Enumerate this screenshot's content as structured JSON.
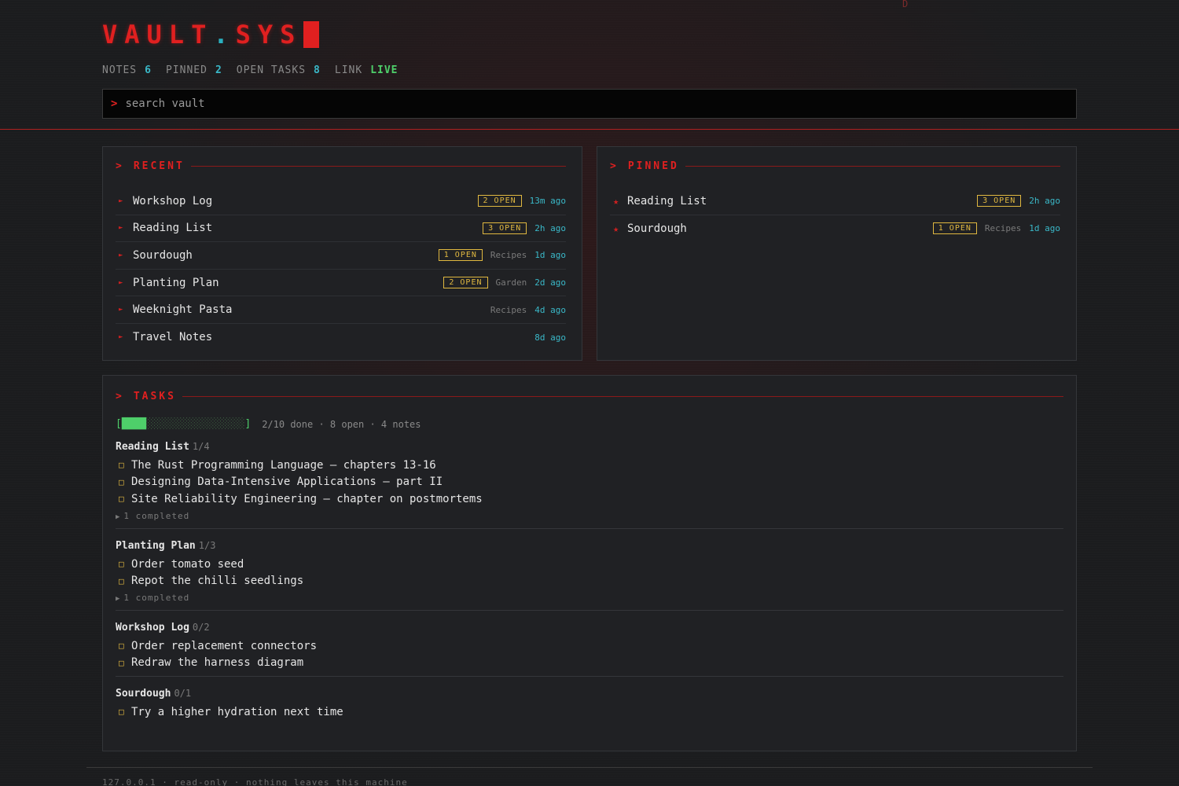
{
  "corner_mark": "D",
  "header": {
    "logo_main": "VAULT",
    "logo_dot": ".",
    "logo_ext": "SYS"
  },
  "stats": [
    {
      "label": "NOTES",
      "value": "6"
    },
    {
      "label": "PINNED",
      "value": "2"
    },
    {
      "label": "OPEN TASKS",
      "value": "8"
    },
    {
      "label": "LINK",
      "value": "LIVE"
    }
  ],
  "search": {
    "prompt": ">",
    "placeholder": "search vault",
    "value": ""
  },
  "recent": {
    "heading": "RECENT",
    "prompt": ">",
    "items": [
      {
        "title": "Workshop Log",
        "badge": "2 OPEN",
        "tag": "",
        "ago": "13m ago"
      },
      {
        "title": "Reading List",
        "badge": "3 OPEN",
        "tag": "",
        "ago": "2h ago"
      },
      {
        "title": "Sourdough",
        "badge": "1 OPEN",
        "tag": "Recipes",
        "ago": "1d ago"
      },
      {
        "title": "Planting Plan",
        "badge": "2 OPEN",
        "tag": "Garden",
        "ago": "2d ago"
      },
      {
        "title": "Weeknight Pasta",
        "badge": "",
        "tag": "Recipes",
        "ago": "4d ago"
      },
      {
        "title": "Travel Notes",
        "badge": "",
        "tag": "",
        "ago": "8d ago"
      }
    ]
  },
  "pinned": {
    "heading": "PINNED",
    "prompt": ">",
    "items": [
      {
        "title": "Reading List",
        "badge": "3 OPEN",
        "tag": "",
        "ago": "2h ago"
      },
      {
        "title": "Sourdough",
        "badge": "1 OPEN",
        "tag": "Recipes",
        "ago": "1d ago"
      }
    ]
  },
  "tasks": {
    "heading": "TASKS",
    "prompt": ">",
    "progress": {
      "done": 2,
      "total": 10,
      "summary": "2/10 done · 8 open · 4 notes"
    },
    "groups": [
      {
        "title": "Reading List",
        "count": "1/4",
        "open": [
          "The Rust Programming Language — chapters 13-16",
          "Designing Data-Intensive Applications — part II",
          "Site Reliability Engineering — chapter on postmortems"
        ],
        "completed_label": "1 completed"
      },
      {
        "title": "Planting Plan",
        "count": "1/3",
        "open": [
          "Order tomato seed",
          "Repot the chilli seedlings"
        ],
        "completed_label": "1 completed"
      },
      {
        "title": "Workshop Log",
        "count": "0/2",
        "open": [
          "Order replacement connectors",
          "Redraw the harness diagram"
        ],
        "completed_label": ""
      },
      {
        "title": "Sourdough",
        "count": "0/1",
        "open": [
          "Try a higher hydration next time"
        ],
        "completed_label": ""
      }
    ]
  },
  "footer": {
    "text": "127.0.0.1 · read-only · nothing leaves this machine"
  },
  "colors": {
    "accent": "#e02020",
    "cyan": "#3ab8c8",
    "badge": "#e0b840",
    "live": "#4ecf6a"
  }
}
